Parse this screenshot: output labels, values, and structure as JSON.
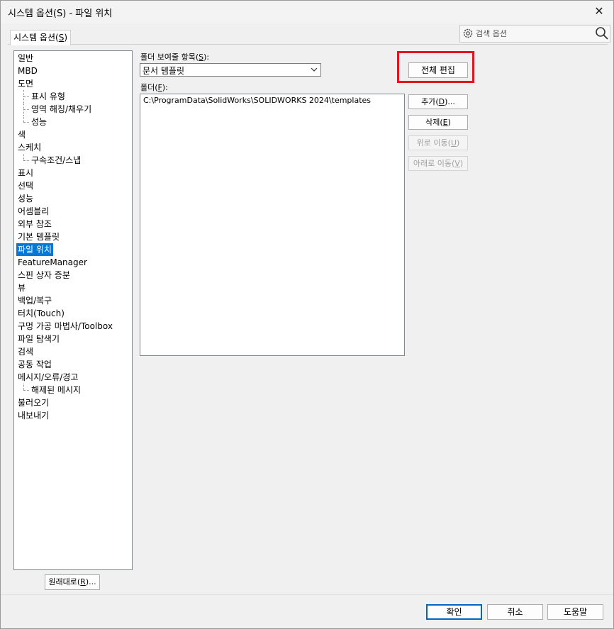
{
  "window": {
    "title": "시스템 옵션(S) - 파일 위치",
    "close_glyph": "✕"
  },
  "tab": {
    "label_prefix": "시스템 옵션(",
    "label_key": "S",
    "label_suffix": ")"
  },
  "search": {
    "placeholder": "검색 옵션",
    "icons": [
      "gear-icon",
      "search-icon"
    ]
  },
  "tree": {
    "items": [
      {
        "label": "일반",
        "level": 0
      },
      {
        "label": "MBD",
        "level": 0
      },
      {
        "label": "도면",
        "level": 0
      },
      {
        "label": "표시 유형",
        "level": 1
      },
      {
        "label": "영역 해칭/채우기",
        "level": 1
      },
      {
        "label": "성능",
        "level": 1
      },
      {
        "label": "색",
        "level": 0
      },
      {
        "label": "스케치",
        "level": 0
      },
      {
        "label": "구속조건/스냅",
        "level": 1
      },
      {
        "label": "표시",
        "level": 0
      },
      {
        "label": "선택",
        "level": 0
      },
      {
        "label": "성능",
        "level": 0
      },
      {
        "label": "어셈블리",
        "level": 0
      },
      {
        "label": "외부 참조",
        "level": 0
      },
      {
        "label": "기본 템플릿",
        "level": 0
      },
      {
        "label": "파일 위치",
        "level": 0,
        "selected": true
      },
      {
        "label": "FeatureManager",
        "level": 0
      },
      {
        "label": "스핀 상자 증분",
        "level": 0
      },
      {
        "label": "뷰",
        "level": 0
      },
      {
        "label": "백업/복구",
        "level": 0
      },
      {
        "label": "터치(Touch)",
        "level": 0
      },
      {
        "label": "구멍 가공 마법사/Toolbox",
        "level": 0
      },
      {
        "label": "파일 탐색기",
        "level": 0
      },
      {
        "label": "검색",
        "level": 0
      },
      {
        "label": "공동 작업",
        "level": 0
      },
      {
        "label": "메시지/오류/경고",
        "level": 0
      },
      {
        "label": "해제된 메시지",
        "level": 1
      },
      {
        "label": "불러오기",
        "level": 0
      },
      {
        "label": "내보내기",
        "level": 0
      }
    ]
  },
  "reset_button": {
    "prefix": "원래대로(",
    "key": "R",
    "suffix": ")..."
  },
  "folder_show": {
    "label_prefix": "폴더 보여줄 항목(",
    "label_key": "S",
    "label_suffix": "):",
    "selected": "문서 템플릿"
  },
  "edit_all_button": "전체 편집",
  "folders": {
    "label_prefix": "폴더(",
    "label_key": "F",
    "label_suffix": "):",
    "entries": [
      "C:\\ProgramData\\SolidWorks\\SOLIDWORKS 2024\\templates"
    ]
  },
  "side_buttons": {
    "add": {
      "prefix": "추가(",
      "key": "D",
      "suffix": ")..."
    },
    "delete": {
      "prefix": "삭제(",
      "key": "E",
      "suffix": ")"
    },
    "move_up": {
      "prefix": "위로 이동(",
      "key": "U",
      "suffix": ")"
    },
    "move_down": {
      "prefix": "아래로 이동(",
      "key": "V",
      "suffix": ")"
    }
  },
  "footer": {
    "ok": "확인",
    "cancel": "취소",
    "help": "도움말"
  },
  "colors": {
    "highlight_border": "#e4151f",
    "selection": "#0078d7",
    "primary_border": "#0067c0"
  }
}
